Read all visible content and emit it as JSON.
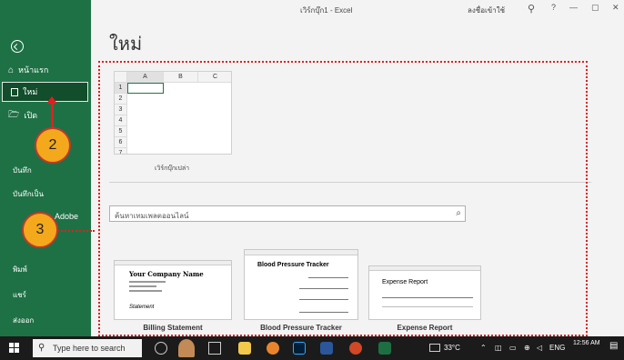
{
  "window": {
    "doc_title": "เวิร์กบุ๊ก1 - Excel",
    "signin": "ลงชื่อเข้าใช้",
    "help": "?",
    "minimize": "—",
    "restore": "▢",
    "close": "✕"
  },
  "sidebar": {
    "items": [
      {
        "label": "หน้าแรก"
      },
      {
        "label": "ใหม่"
      },
      {
        "label": "เปิด"
      }
    ],
    "lower": [
      "บันทึก",
      "บันทึกเป็น",
      "Adobe",
      "พิมพ์",
      "แชร์",
      "ส่งออก"
    ]
  },
  "main": {
    "page_title": "ใหม่",
    "blank_workbook": {
      "label": "เวิร์กบุ๊กเปล่า",
      "columns": [
        "A",
        "B",
        "C"
      ],
      "rows": [
        "1",
        "2",
        "3",
        "4",
        "5",
        "6",
        "7"
      ]
    },
    "search": {
      "placeholder": "ค้นหาเทมเพลตออนไลน์"
    },
    "templates": [
      {
        "label": "Billing Statement",
        "heading": "Your Company Name",
        "sub": "Statement"
      },
      {
        "label": "Blood Pressure Tracker",
        "heading": "Blood Pressure Tracker"
      },
      {
        "label": "Expense Report",
        "heading": "Expense Report"
      }
    ]
  },
  "annotations": {
    "step2": "2",
    "step3": "3"
  },
  "taskbar": {
    "search_placeholder": "Type here to search",
    "temperature": "33°C",
    "lang": "ENG",
    "time": "12:56 AM"
  },
  "colors": {
    "excel_green": "#1e7145",
    "annotation_red": "#e02020",
    "annotation_circle": "#f4a81c"
  }
}
